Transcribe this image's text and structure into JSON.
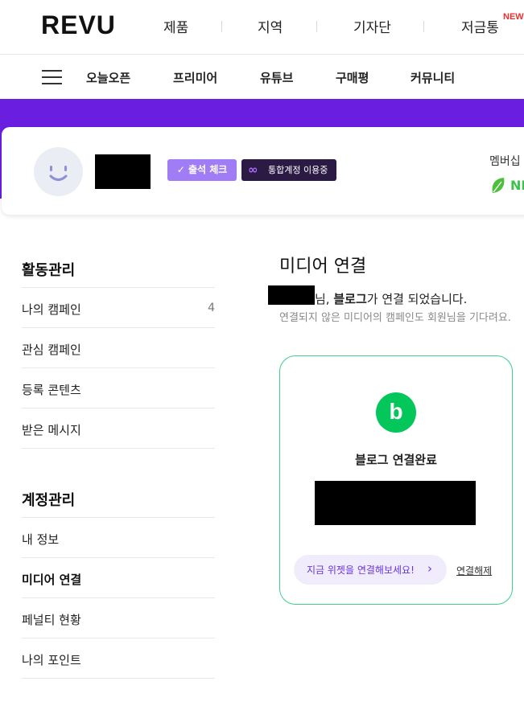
{
  "header": {
    "logo": "REVU",
    "nav": [
      "제품",
      "지역",
      "기자단",
      "저금통"
    ],
    "new_badge": "NEW"
  },
  "subnav": {
    "menu_icon": "hamburger-menu-icon",
    "items": [
      "오늘오픈",
      "프리미어",
      "유튜브",
      "구매평",
      "커뮤니티"
    ]
  },
  "profile": {
    "attendance_label": "출석 체크",
    "integrated_label": "통합계정 이용중",
    "membership_label": "멤버십",
    "membership_tier": "NE"
  },
  "sidebar": {
    "section1_title": "활동관리",
    "section1_items": [
      {
        "label": "나의 캠페인",
        "count": "4"
      },
      {
        "label": "관심 캠페인",
        "count": ""
      },
      {
        "label": "등록 콘텐츠",
        "count": ""
      },
      {
        "label": "받은 메시지",
        "count": ""
      }
    ],
    "section2_title": "계정관리",
    "section2_items": [
      {
        "label": "내 정보"
      },
      {
        "label": "미디어 연결"
      },
      {
        "label": "페널티 현황"
      },
      {
        "label": "나의 포인트"
      }
    ]
  },
  "main": {
    "title": "미디어 연결",
    "msg_suffix_1": "님, ",
    "msg_bold": "블로그",
    "msg_suffix_2": "가 연결 되었습니다.",
    "msg_sub": "연결되지 않은 미디어의 캠페인도 회원님을 기다려요.",
    "blog_card": {
      "logo_letter": "b",
      "status": "블로그 연결완료",
      "widget_label": "지금 위젯을 연결해보세요!",
      "unlink_label": "연결해제"
    }
  },
  "colors": {
    "brand_purple": "#6a1ee0",
    "blog_green": "#03c75a",
    "card_border": "#3ccf8e"
  }
}
